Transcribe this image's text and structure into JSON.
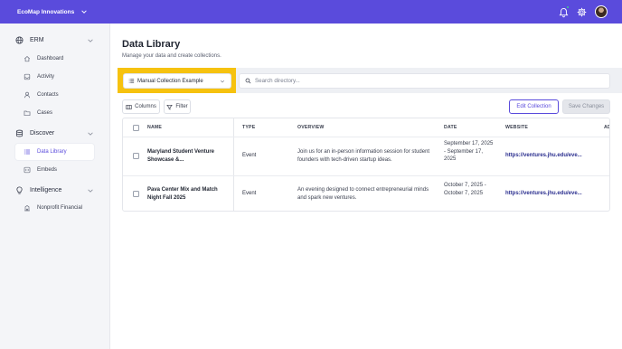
{
  "topbar": {
    "org_name": "EcoMap Innovations",
    "accent": "#5a4bdc",
    "icons": [
      "chevron-down-icon",
      "bell-icon",
      "gear-icon"
    ]
  },
  "sidebar": {
    "sections": [
      {
        "label": "ERM",
        "icon": "globe-icon",
        "items": [
          {
            "label": "Dashboard",
            "icon": "home-icon"
          },
          {
            "label": "Activity",
            "icon": "inbox-icon"
          },
          {
            "label": "Contacts",
            "icon": "user-icon"
          },
          {
            "label": "Cases",
            "icon": "folder-icon"
          }
        ]
      },
      {
        "label": "Discover",
        "icon": "database-icon",
        "items": [
          {
            "label": "Data Library",
            "icon": "list-icon",
            "active": true
          },
          {
            "label": "Embeds",
            "icon": "code-icon"
          }
        ]
      },
      {
        "label": "Intelligence",
        "icon": "lightbulb-icon",
        "items": [
          {
            "label": "Nonprofit Financial",
            "icon": "building-icon"
          }
        ]
      }
    ]
  },
  "main": {
    "title": "Data Library",
    "subtitle": "Manage your data and create collections.",
    "collection_select": "Manual Collection Example",
    "search_placeholder": "Search directory...",
    "columns_button": "Columns",
    "filter_button": "Filter",
    "edit_button": "Edit Collection",
    "save_button": "Save Changes",
    "highlight_color": "#f6c20f"
  },
  "table": {
    "headers": [
      "NAME",
      "TYPE",
      "OVERVIEW",
      "DATE",
      "WEBSITE",
      "AD"
    ],
    "rows": [
      {
        "name": "Maryland Student Venture Showcase &...",
        "type": "Event",
        "overview": "Join us for an in-person information session for student founders with tech-driven startup ideas.",
        "date": "September 17, 2025 - September 17, 2025",
        "website": "https://ventures.jhu.edu/eve..."
      },
      {
        "name": "Pava Center Mix and Match Night Fall 2025",
        "type": "Event",
        "overview": "An evening designed to connect entrepreneurial minds and spark new ventures.",
        "date": "October 7, 2025 - October 7, 2025",
        "website": "https://ventures.jhu.edu/eve..."
      }
    ]
  }
}
